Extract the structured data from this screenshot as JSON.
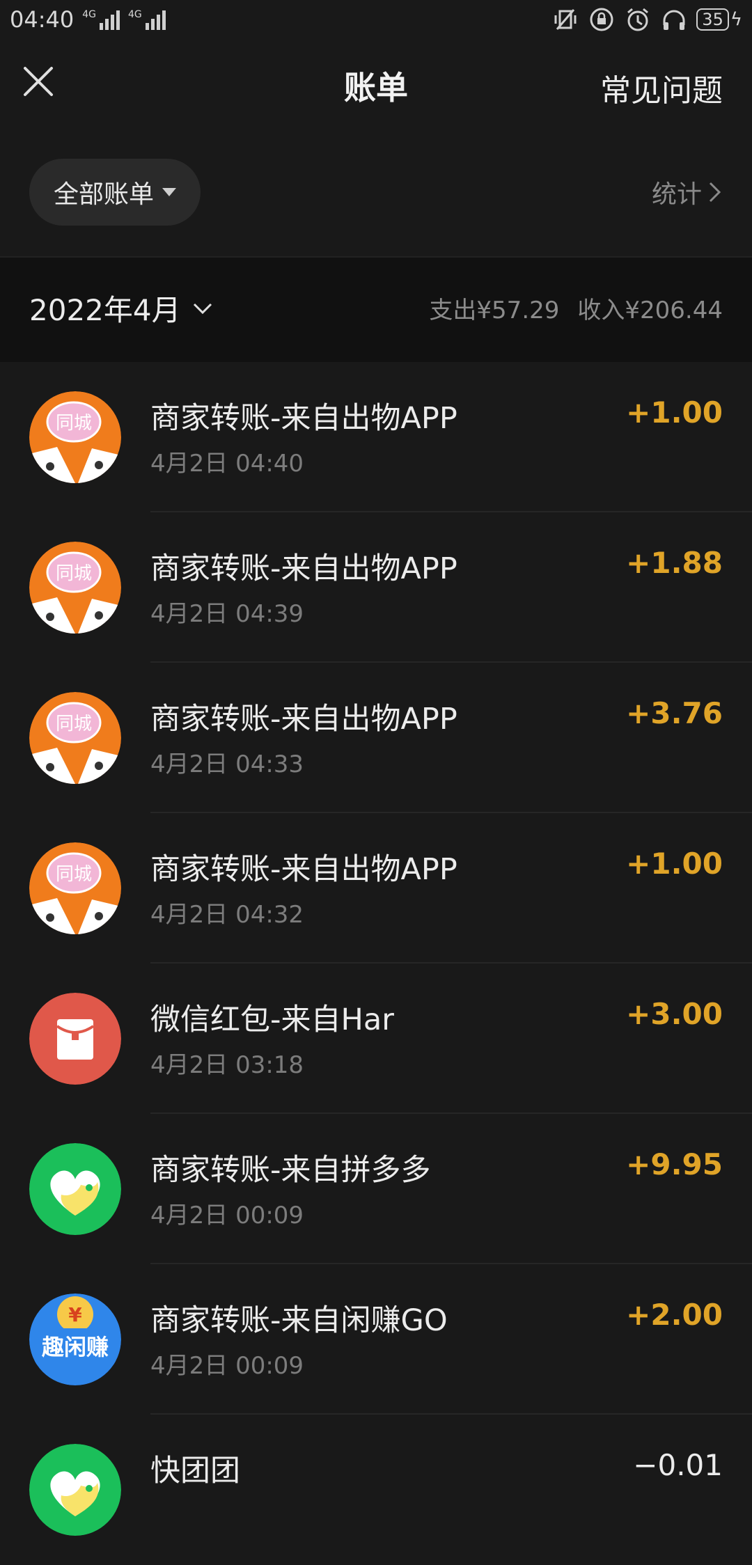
{
  "status_bar": {
    "time": "04:40",
    "network1": "4G",
    "network2": "4G",
    "battery": "35"
  },
  "header": {
    "title": "账单",
    "faq_label": "常见问题"
  },
  "filter": {
    "label": "全部账单",
    "stats_label": "统计"
  },
  "month": {
    "label": "2022年4月",
    "expense": "支出¥57.29",
    "income": "收入¥206.44"
  },
  "transactions": [
    {
      "title": "商家转账-来自出物APP",
      "time": "4月2日 04:40",
      "amount": "+1.00",
      "icon": "tongcheng-cat-icon"
    },
    {
      "title": "商家转账-来自出物APP",
      "time": "4月2日 04:39",
      "amount": "+1.88",
      "icon": "tongcheng-cat-icon"
    },
    {
      "title": "商家转账-来自出物APP",
      "time": "4月2日 04:33",
      "amount": "+3.76",
      "icon": "tongcheng-cat-icon"
    },
    {
      "title": "商家转账-来自出物APP",
      "time": "4月2日 04:32",
      "amount": "+1.00",
      "icon": "tongcheng-cat-icon"
    },
    {
      "title": "微信红包-来自Har",
      "time": "4月2日 03:18",
      "amount": "+3.00",
      "icon": "red-packet-icon"
    },
    {
      "title": "商家转账-来自拼多多",
      "time": "4月2日 00:09",
      "amount": "+9.95",
      "icon": "green-heart-icon"
    },
    {
      "title": "商家转账-来自闲赚GO",
      "time": "4月2日 00:09",
      "amount": "+2.00",
      "icon": "quxianzhuan-icon"
    },
    {
      "title": "快团团",
      "time": "",
      "amount": "−0.01",
      "icon": "green-heart-icon"
    }
  ],
  "icon_labels": {
    "tongcheng": "同城",
    "yuan": "¥",
    "qxz": "趣闲赚"
  },
  "colors": {
    "income_amount": "#e0a428",
    "background": "#191919"
  }
}
